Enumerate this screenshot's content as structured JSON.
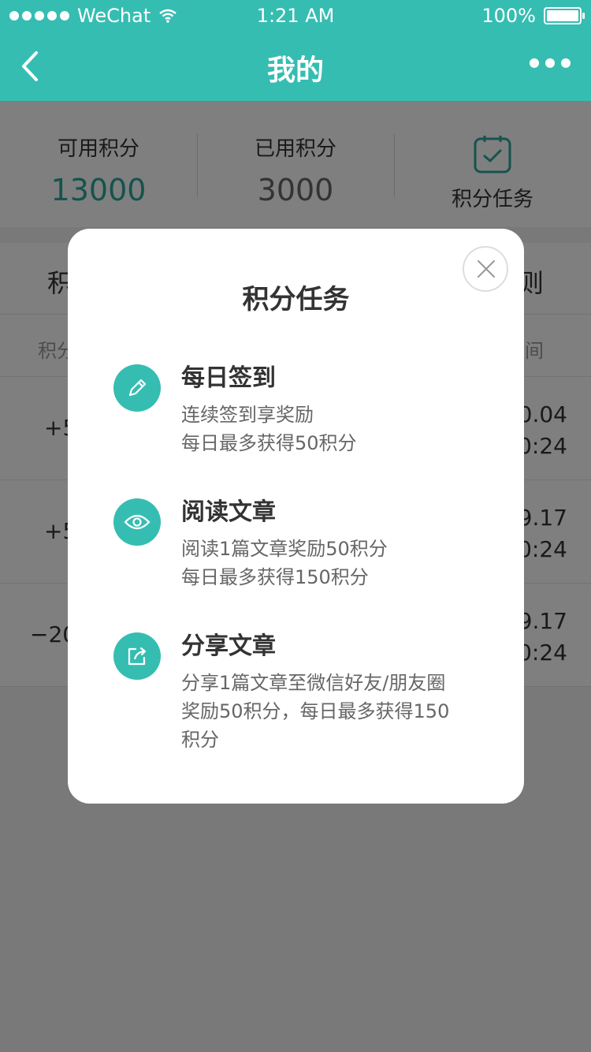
{
  "statusbar": {
    "carrier": "WeChat",
    "time": "1:21 AM",
    "battery": "100%"
  },
  "nav": {
    "title": "我的"
  },
  "summary": {
    "available_label": "可用积分",
    "available_value": "13000",
    "used_label": "已用积分",
    "used_value": "3000",
    "tasks_label": "积分任务"
  },
  "list": {
    "head_left": "积",
    "head_right": "则",
    "sub_left": "积分",
    "sub_right": "间",
    "rows": [
      {
        "points": "+5",
        "date": "0.04",
        "time": "0:24"
      },
      {
        "points": "+5",
        "date": "9.17",
        "time": "0:24"
      },
      {
        "points": "−20",
        "date": "9.17",
        "time": "0:24"
      }
    ]
  },
  "modal": {
    "title": "积分任务",
    "tasks": [
      {
        "icon": "pencil-icon",
        "title": "每日签到",
        "desc1": "连续签到享奖励",
        "desc2": "每日最多获得50积分",
        "desc3": ""
      },
      {
        "icon": "eye-icon",
        "title": "阅读文章",
        "desc1": "阅读1篇文章奖励50积分",
        "desc2": "每日最多获得150积分",
        "desc3": ""
      },
      {
        "icon": "share-icon",
        "title": "分享文章",
        "desc1": "分享1篇文章至微信好友/朋友圈",
        "desc2": "奖励50积分，每日最多获得150",
        "desc3": "积分"
      }
    ]
  },
  "colors": {
    "accent": "#36bdb2",
    "accent_text": "#2aa79d"
  }
}
